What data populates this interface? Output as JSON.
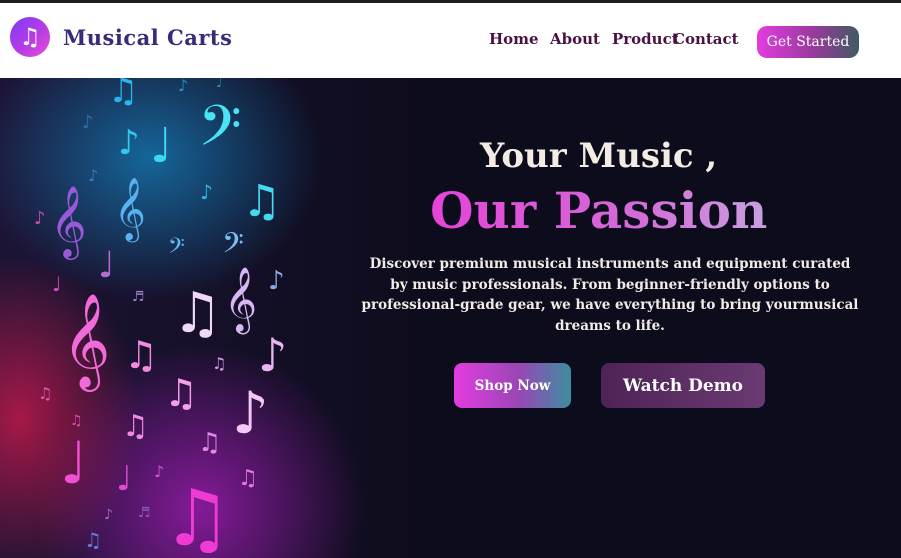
{
  "brand": {
    "name": "Musical Carts",
    "logo_glyph": "♫",
    "colors": {
      "nav_text": "#4a1244",
      "brand_text": "#3b2a7a",
      "accent_pink": "#e23ce0",
      "hero_bg": "#0d0c1c"
    }
  },
  "nav": {
    "links": [
      {
        "label": "Home"
      },
      {
        "label": "About"
      },
      {
        "label": "Product"
      },
      {
        "label": "Contact"
      }
    ],
    "cta_label": "Get Started"
  },
  "hero": {
    "title_line1": "Your Music ,",
    "title_line2": "Our Passion",
    "description": "Discover premium musical instruments and equipment curated by music professionals. From beginner-friendly options to professional-grade gear, we have everything to bring yourmusical dreams to life.",
    "primary_button": "Shop Now",
    "secondary_button": "Watch Demo"
  },
  "art": {
    "notes": [
      "♩",
      "♪",
      "♫",
      "♬",
      "𝄞",
      "𝄢"
    ]
  }
}
